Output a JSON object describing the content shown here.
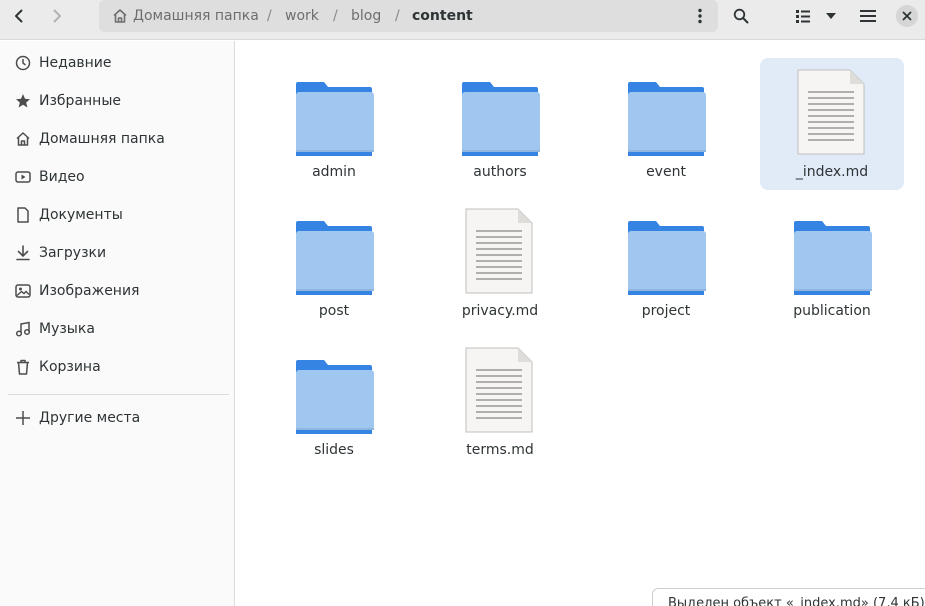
{
  "nav": {
    "back_icon": "chevron-left-icon",
    "forward_icon": "chevron-right-icon"
  },
  "path": {
    "crumbs": [
      "Домашняя папка",
      "work",
      "blog",
      "content"
    ],
    "separator": "/"
  },
  "toolbar": {
    "search_icon": "search-icon",
    "view_icon": "list-view-icon",
    "view_dropdown_icon": "chevron-down-icon",
    "menu_icon": "hamburger-menu-icon",
    "close_icon": "close-icon"
  },
  "sidebar": {
    "items": [
      {
        "label": "Недавние",
        "icon": "clock-icon"
      },
      {
        "label": "Избранные",
        "icon": "star-icon"
      },
      {
        "label": "Домашняя папка",
        "icon": "home-icon"
      },
      {
        "label": "Видео",
        "icon": "video-icon"
      },
      {
        "label": "Документы",
        "icon": "document-icon"
      },
      {
        "label": "Загрузки",
        "icon": "download-icon"
      },
      {
        "label": "Изображения",
        "icon": "image-icon"
      },
      {
        "label": "Музыка",
        "icon": "music-icon"
      },
      {
        "label": "Корзина",
        "icon": "trash-icon"
      }
    ],
    "other": {
      "label": "Другие места",
      "icon": "plus-icon"
    }
  },
  "files": [
    {
      "name": "admin",
      "type": "folder",
      "selected": false
    },
    {
      "name": "authors",
      "type": "folder",
      "selected": false
    },
    {
      "name": "event",
      "type": "folder",
      "selected": false
    },
    {
      "name": "_index.md",
      "type": "file",
      "selected": true
    },
    {
      "name": "post",
      "type": "folder",
      "selected": false
    },
    {
      "name": "privacy.md",
      "type": "file",
      "selected": false
    },
    {
      "name": "project",
      "type": "folder",
      "selected": false
    },
    {
      "name": "publication",
      "type": "folder",
      "selected": false
    },
    {
      "name": "slides",
      "type": "folder",
      "selected": false
    },
    {
      "name": "terms.md",
      "type": "file",
      "selected": false
    }
  ],
  "status": {
    "text": "Выделен объект «_index.md» (7,4 кБ)"
  },
  "colors": {
    "folder_top": "#3584e4",
    "folder_front_top": "#99c1f1",
    "folder_front_bottom": "#a9d4ef",
    "selection": "#e1ebf8",
    "file_page": "#f6f5f4"
  }
}
